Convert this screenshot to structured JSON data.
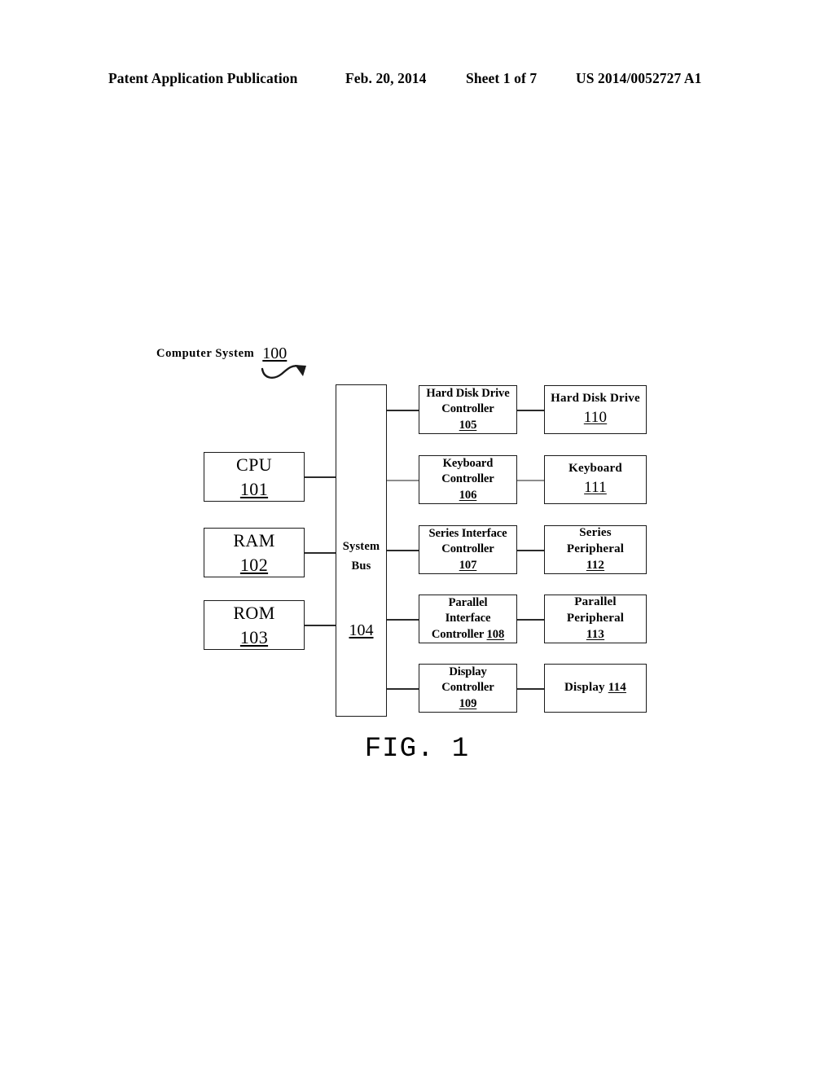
{
  "header": {
    "publication": "Patent Application Publication",
    "date": "Feb. 20, 2014",
    "sheet": "Sheet 1 of 7",
    "patent_number": "US 2014/0052727 A1"
  },
  "figure": {
    "label": "FIG. 1",
    "caption_text": "Computer System",
    "caption_number": "100"
  },
  "bus": {
    "line1": "System",
    "line2": "Bus",
    "number": "104"
  },
  "memory_blocks": [
    {
      "name": "CPU",
      "number": "101"
    },
    {
      "name": "RAM",
      "number": "102"
    },
    {
      "name": "ROM",
      "number": "103"
    }
  ],
  "controllers": [
    {
      "line1": "Hard Disk Drive",
      "line2": "Controller",
      "number": "105"
    },
    {
      "line1": "Keyboard",
      "line2": "Controller",
      "number": "106"
    },
    {
      "line1": "Series Interface",
      "line2": "Controller",
      "number": "107"
    },
    {
      "line1": "Parallel",
      "line2": "Interface",
      "line3": "Controller",
      "number": "108"
    },
    {
      "line1": "Display",
      "line2": "Controller",
      "number": "109"
    }
  ],
  "peripherals": [
    {
      "line1": "Hard Disk Drive",
      "number": "110"
    },
    {
      "line1": "Keyboard",
      "number": "111"
    },
    {
      "line1": "Series",
      "line2": "Peripheral",
      "number": "112"
    },
    {
      "line1": "Parallel",
      "line2": "Peripheral",
      "number": "113"
    },
    {
      "line1": "Display",
      "number": "114"
    }
  ],
  "colors": {
    "ink": "#1a1a1a",
    "paper": "#ffffff"
  }
}
